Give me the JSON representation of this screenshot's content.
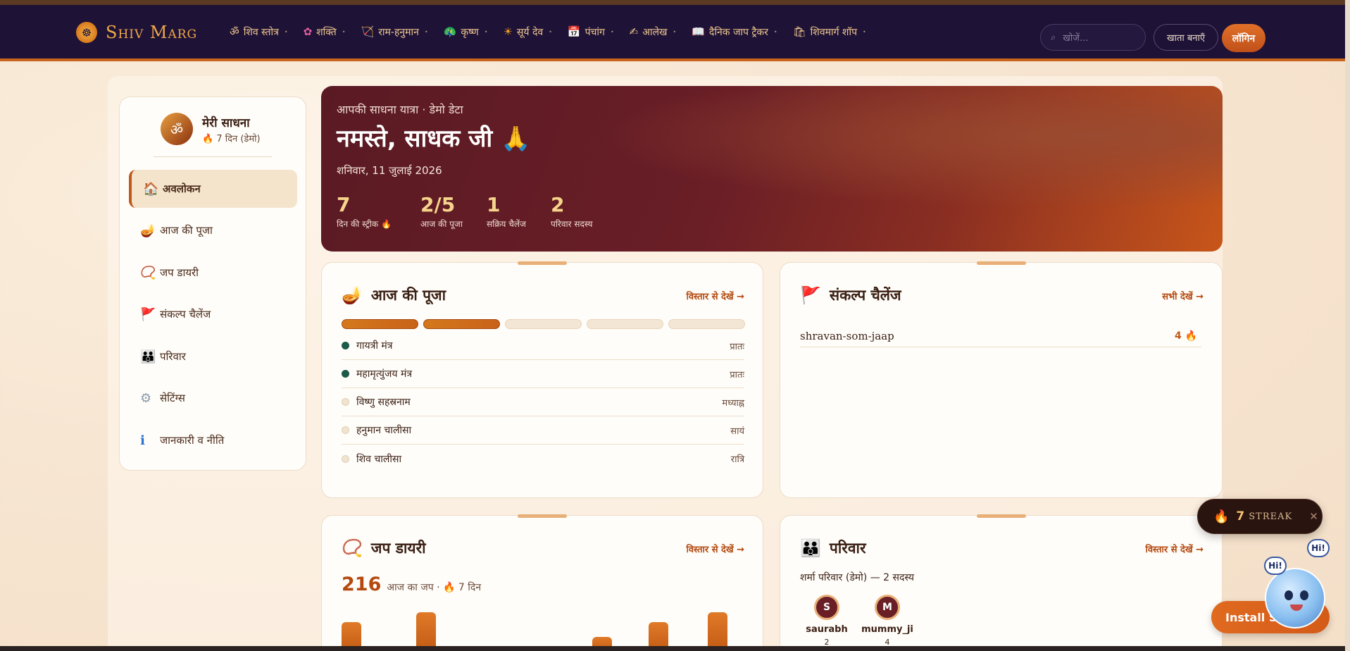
{
  "brand": {
    "name": "Shiv Marg",
    "logo_glyph": "☸"
  },
  "nav": [
    {
      "icon": "ॐ",
      "label": "शिव स्तोत्र"
    },
    {
      "icon": "✿",
      "label": "शक्ति"
    },
    {
      "icon": "🏹",
      "label": "राम-हनुमान"
    },
    {
      "icon": "🦚",
      "label": "कृष्ण"
    },
    {
      "icon": "☀",
      "label": "सूर्य देव"
    },
    {
      "icon": "📅",
      "label": "पंचांग"
    },
    {
      "icon": "✍",
      "label": "आलेख"
    },
    {
      "icon": "📖",
      "label": "दैनिक जाप ट्रैकर"
    },
    {
      "icon": "🛍",
      "label": "शिवमार्ग शॉप"
    }
  ],
  "header": {
    "search_placeholder": "खोजें...",
    "search_icon": "⌕",
    "account_label": "खाता बनाएँ",
    "login_label": "लॉगिन"
  },
  "sidebar": {
    "avatar_glyph": "ॐ",
    "title": "मेरी साधना",
    "subtitle": "🔥 7 दिन (डेमो)",
    "items": [
      {
        "icon": "🏠",
        "label": "अवलोकन",
        "active": true
      },
      {
        "icon": "🪔",
        "label": "आज की पूजा"
      },
      {
        "icon": "📿",
        "label": "जप डायरी"
      },
      {
        "icon": "🚩",
        "label": "संकल्प चैलेंज"
      },
      {
        "icon": "👪",
        "label": "परिवार"
      },
      {
        "icon": "⚙",
        "label": "सेटिंग्स"
      },
      {
        "icon": "ℹ",
        "label": "जानकारी व नीति"
      }
    ]
  },
  "hero": {
    "kicker": "आपकी साधना यात्रा · डेमो डेटा",
    "title": "नमस्ते, साधक जी 🙏",
    "date": "शनिवार, 11 जुलाई 2026",
    "stats": [
      {
        "value": "7",
        "label": "दिन की स्ट्रीक 🔥"
      },
      {
        "value": "2/5",
        "label": "आज की पूजा"
      },
      {
        "value": "1",
        "label": "सक्रिय चैलेंज"
      },
      {
        "value": "2",
        "label": "परिवार सदस्य"
      }
    ]
  },
  "puja_card": {
    "icon": "🪔",
    "title": "आज की पूजा",
    "link": "विस्तार से देखें →",
    "progress_done": 2,
    "progress_total": 5,
    "items": [
      {
        "name": "गायत्री मंत्र",
        "time": "प्रातः",
        "done": true
      },
      {
        "name": "महामृत्युंजय मंत्र",
        "time": "प्रातः",
        "done": true
      },
      {
        "name": "विष्णु सहस्रनाम",
        "time": "मध्याह्न",
        "done": false
      },
      {
        "name": "हनुमान चालीसा",
        "time": "सायं",
        "done": false
      },
      {
        "name": "शिव चालीसा",
        "time": "रात्रि",
        "done": false
      }
    ]
  },
  "challenge_card": {
    "icon": "🚩",
    "title": "संकल्प चैलेंज",
    "link": "सभी देखें →",
    "items": [
      {
        "name": "shravan-som-jaap",
        "count": "4 🔥"
      }
    ]
  },
  "jap_card": {
    "icon": "📿",
    "title": "जप डायरी",
    "link": "विस्तार से देखें →",
    "count": "216",
    "label": "आज का जप · 🔥 7 दिन",
    "bars": [
      0.62,
      0.82,
      0,
      0.1,
      0.32,
      0.62,
      0.82
    ]
  },
  "family_card": {
    "icon": "👪",
    "title": "परिवार",
    "link": "विस्तार से देखें →",
    "subtitle": "शर्मा परिवार (डेमो) — 2 सदस्य",
    "members": [
      {
        "initial": "S",
        "name": "saurabh",
        "count": "2"
      },
      {
        "initial": "M",
        "name": "mummy_ji",
        "count": "4"
      }
    ]
  },
  "streak_pill": {
    "icon": "🔥",
    "value": "7",
    "label": "STREAK",
    "close": "✕"
  },
  "chat": {
    "hi_1": "Hi!",
    "hi_2": "Hi!"
  },
  "install": {
    "label": "Install Shiv"
  },
  "colors": {
    "accent": "#c0581c",
    "header_bg": "#1e1236",
    "hero_start": "#5a1a24",
    "hero_end": "#c8561a"
  }
}
